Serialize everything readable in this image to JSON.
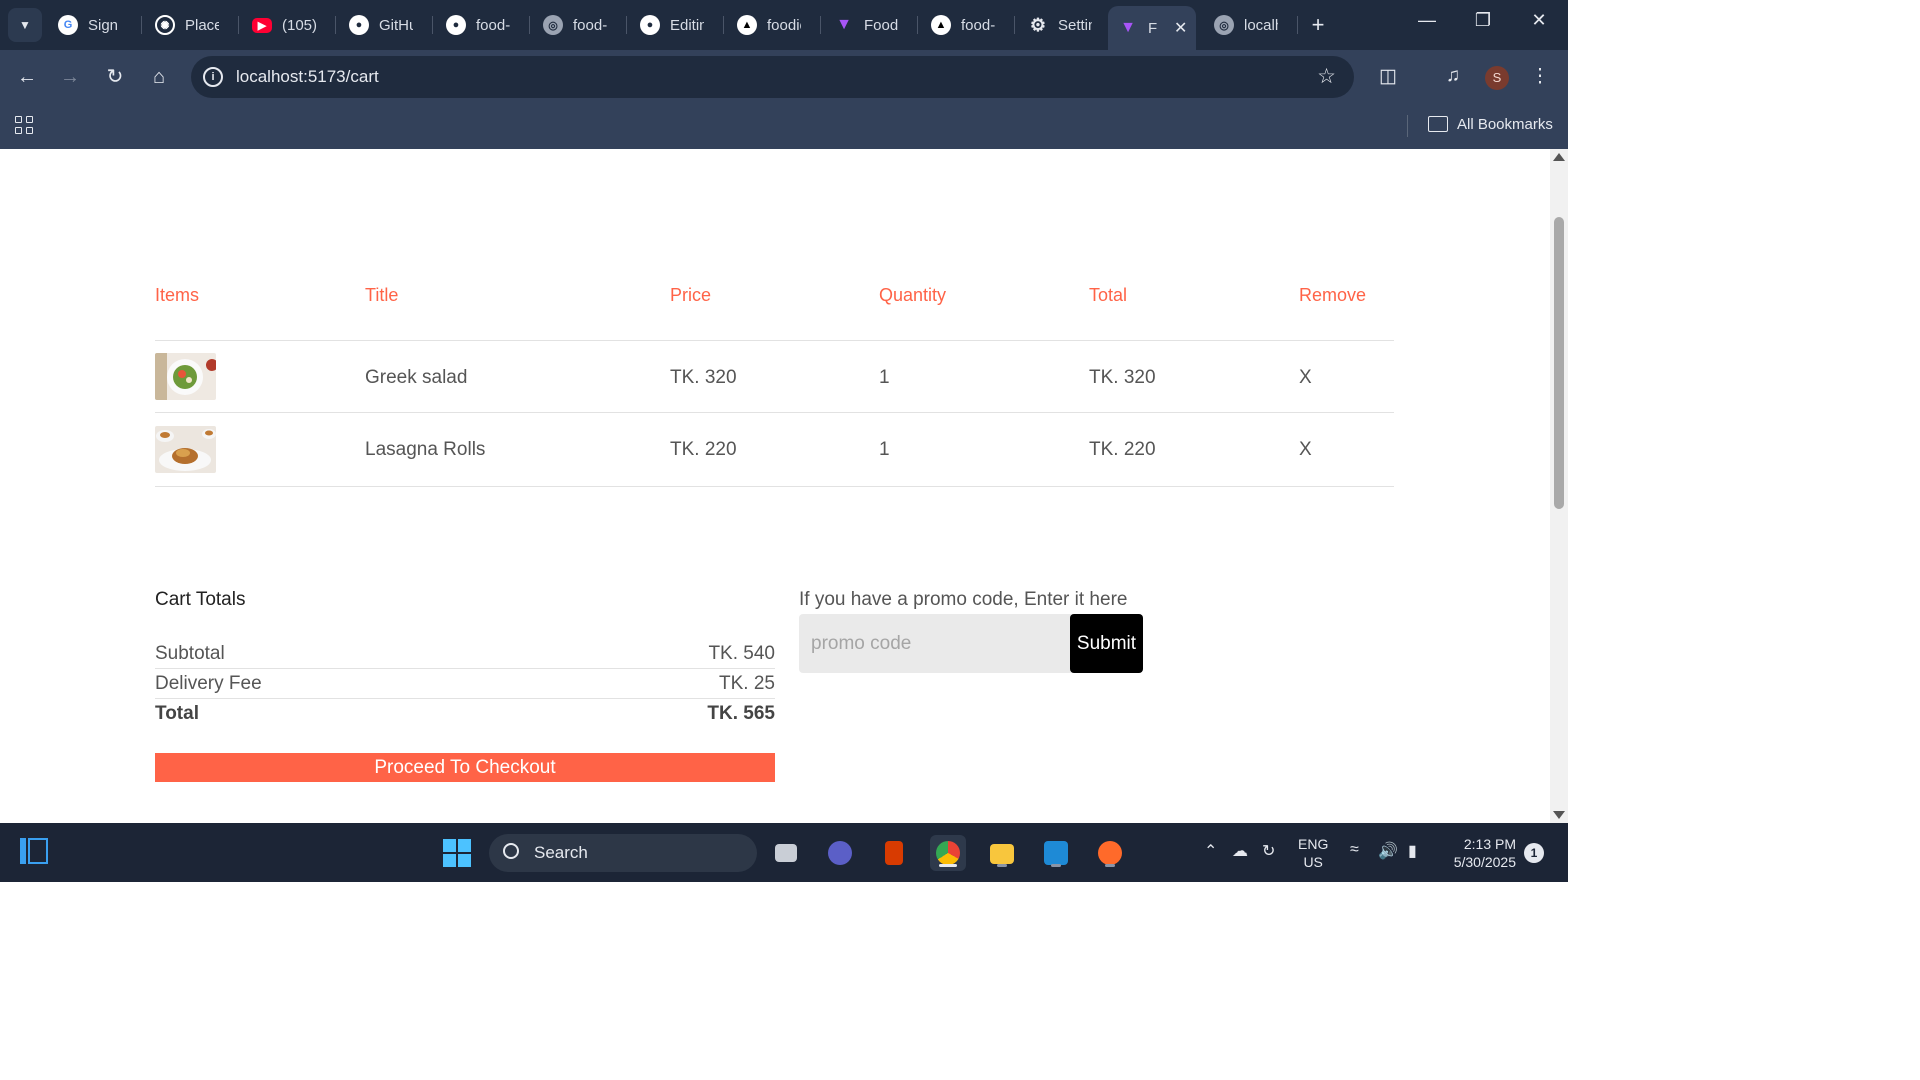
{
  "browser": {
    "tabs": [
      {
        "label": "Sign in",
        "icon": "google-icon",
        "color": "#ffffff"
      },
      {
        "label": "Place",
        "icon": "openai-icon",
        "color": "#ffffff"
      },
      {
        "label": "(105)",
        "icon": "youtube-icon",
        "color": "#ff0033"
      },
      {
        "label": "GitHub",
        "icon": "github-icon",
        "color": "#ffffff"
      },
      {
        "label": "food-",
        "icon": "github-icon",
        "color": "#ffffff"
      },
      {
        "label": "food-",
        "icon": "globe-icon",
        "color": "#9aa3b2"
      },
      {
        "label": "Editing",
        "icon": "github-icon",
        "color": "#ffffff"
      },
      {
        "label": "foodie",
        "icon": "vercel-icon",
        "color": "#ffffff"
      },
      {
        "label": "Foodi",
        "icon": "vite-icon",
        "color": "#a855f7"
      },
      {
        "label": "food-",
        "icon": "vercel-icon",
        "color": "#ffffff"
      },
      {
        "label": "Settin",
        "icon": "gear-icon",
        "color": "#e6e9ef"
      },
      {
        "label": "F",
        "icon": "vite-icon",
        "color": "#a855f7",
        "active": true
      },
      {
        "label": "localh",
        "icon": "globe-icon",
        "color": "#9aa3b2"
      }
    ],
    "url": "localhost:5173/cart",
    "bookmarks_label": "All Bookmarks",
    "profile_initial": "S"
  },
  "cart": {
    "headers": [
      "Items",
      "Title",
      "Price",
      "Quantity",
      "Total",
      "Remove"
    ],
    "rows": [
      {
        "title": "Greek salad",
        "price": "TK. 320",
        "quantity": "1",
        "total": "TK. 320",
        "remove": "X"
      },
      {
        "title": "Lasagna Rolls",
        "price": "TK. 220",
        "quantity": "1",
        "total": "TK. 220",
        "remove": "X"
      }
    ]
  },
  "totals": {
    "title": "Cart Totals",
    "subtotal_label": "Subtotal",
    "subtotal_value": "TK. 540",
    "delivery_label": "Delivery Fee",
    "delivery_value": "TK. 25",
    "total_label": "Total",
    "total_value": "TK. 565",
    "checkout_label": "Proceed To Checkout"
  },
  "promo": {
    "label": "If you have a promo code, Enter it here",
    "placeholder": "promo code",
    "submit_label": "Submit"
  },
  "taskbar": {
    "search_label": "Search",
    "lang_line1": "ENG",
    "lang_line2": "US",
    "time": "2:13 PM",
    "date": "5/30/2025",
    "notification_count": "1"
  },
  "colors": {
    "accent": "#ff6347",
    "chrome_dark": "#1f2b3e",
    "chrome_mid": "#33415a"
  }
}
